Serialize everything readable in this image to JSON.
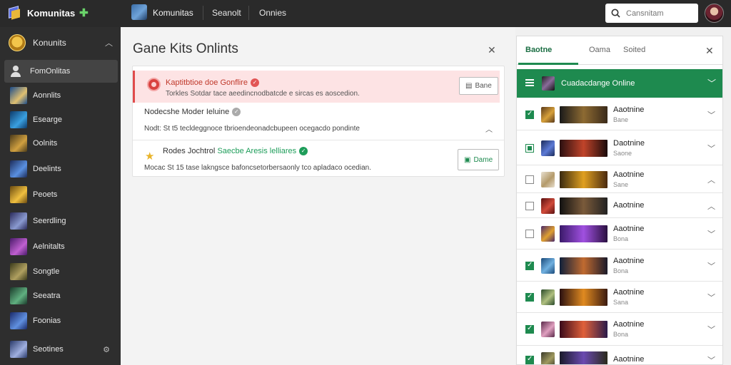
{
  "app": {
    "brand": "Komunitas",
    "header_title": "Komunitas",
    "nav": [
      "Seanolt",
      "Onnies"
    ]
  },
  "search": {
    "placeholder": "Cansnitam"
  },
  "sidebar": {
    "header": "Konunits",
    "active_item": "FomOnlitas",
    "items": [
      {
        "label": "Aonnlits",
        "icon": "game-thumb"
      },
      {
        "label": "Esearge",
        "icon": "game-thumb"
      },
      {
        "label": "Oolnits",
        "icon": "game-thumb"
      },
      {
        "label": "Deelints",
        "icon": "game-thumb"
      },
      {
        "label": "Peoets",
        "icon": "game-thumb"
      },
      {
        "label": "Seerdling",
        "icon": "game-thumb"
      },
      {
        "label": "Aelnitalts",
        "icon": "game-thumb"
      },
      {
        "label": "Songtle",
        "icon": "game-thumb"
      },
      {
        "label": "Seeatra",
        "icon": "game-thumb"
      },
      {
        "label": "Foonias",
        "icon": "game-thumb"
      },
      {
        "label": "Seotines",
        "icon": "game-thumb"
      }
    ]
  },
  "main": {
    "title": "Gane Kits Onlints",
    "alert": {
      "title": "Kaptitbtioe doe Gonflire",
      "desc": "Torkles Sotdar tace aeedincnodbatcde e sircas es aoscedion.",
      "button": "Bane"
    },
    "row1": {
      "title": "Nodecshe Moder Ieluine",
      "desc": "Nodt: St t5 tecldeggnoce tbrioendeonadcbupeen ocegacdo pondinte"
    },
    "row2": {
      "title": "Rodes Jochtrol",
      "link": "Saecbe Aresis lelliares",
      "desc": "Mocac St 15 tase lakngsce bafoncsetorbersaonly tco apladaco ocedian.",
      "button": "Dame"
    }
  },
  "rpanel": {
    "tabs": [
      "Baotne",
      "Oama",
      "Soited"
    ],
    "group_title": "Cuadacdange Online",
    "items": [
      {
        "title": "Aaotnine",
        "sub": "Bane",
        "state": "on",
        "expanded": false,
        "thumb": [
          "#5a3a1a",
          "#d7a03a"
        ],
        "banner": [
          "#1a1a1a",
          "#8d6a32",
          "#3a2a1a"
        ]
      },
      {
        "title": "Daotnine",
        "sub": "Saone",
        "state": "half",
        "expanded": false,
        "thumb": [
          "#1c2c5a",
          "#5c7ad6"
        ],
        "banner": [
          "#2a0f10",
          "#c0442a",
          "#1a0a0a"
        ]
      },
      {
        "title": "Aaotnine",
        "sub": "Sane",
        "state": "off",
        "expanded": true,
        "thumb": [
          "#e8e0d0",
          "#b49a6a"
        ],
        "banner": [
          "#3a2a10",
          "#e0a020",
          "#4a2a10"
        ]
      },
      {
        "title": "Aaotnine",
        "sub": "",
        "state": "off",
        "expanded": true,
        "thumb": [
          "#5a1010",
          "#d04a3a"
        ],
        "banner": [
          "#111111",
          "#7a5a3a",
          "#222222"
        ]
      },
      {
        "title": "Aaotnine",
        "sub": "Bona",
        "state": "off",
        "expanded": false,
        "thumb": [
          "#4a2a6a",
          "#e0a030"
        ],
        "banner": [
          "#3a1a6a",
          "#a050e0",
          "#2a1040"
        ]
      },
      {
        "title": "Aaotnine",
        "sub": "Bona",
        "state": "on",
        "expanded": false,
        "thumb": [
          "#1a4a7a",
          "#70b0e0"
        ],
        "banner": [
          "#10203a",
          "#c06a30",
          "#1a1a2a"
        ]
      },
      {
        "title": "Aaotnine",
        "sub": "Sana",
        "state": "on",
        "expanded": false,
        "thumb": [
          "#2a4a2a",
          "#b0c080"
        ],
        "banner": [
          "#2a1010",
          "#e08a20",
          "#3a1a10"
        ]
      },
      {
        "title": "Aaotnine",
        "sub": "Bona",
        "state": "on",
        "expanded": false,
        "thumb": [
          "#5a2a4a",
          "#e0a0c0"
        ],
        "banner": [
          "#3a0a1a",
          "#e0603a",
          "#2a1a4a"
        ]
      },
      {
        "title": "Aaotnine",
        "sub": "",
        "state": "on",
        "expanded": false,
        "thumb": [
          "#3a3a2a",
          "#a09a60"
        ],
        "banner": [
          "#1a1a2a",
          "#6a4ab0",
          "#2a2a1a"
        ]
      }
    ]
  },
  "colors": {
    "accent_green": "#1e8a4f",
    "alert_red": "#e04b4b",
    "sidebar_bg": "#2e2e2e"
  },
  "sidebar_thumbs": [
    [
      "#1b4c8a",
      "#e0c070"
    ],
    [
      "#0d3a6a",
      "#3aa0e0"
    ],
    [
      "#4a3a1a",
      "#d0a040"
    ],
    [
      "#1c2c5a",
      "#5a90e0"
    ],
    [
      "#6a4a10",
      "#f0c040"
    ],
    [
      "#2a2a5a",
      "#8a9ad0"
    ],
    [
      "#4a1a6a",
      "#c060d0"
    ],
    [
      "#3a3a1a",
      "#b0a060"
    ],
    [
      "#1a3a2a",
      "#60b080"
    ],
    [
      "#1a2a6a",
      "#6090e0"
    ],
    [
      "#2a3a6a",
      "#a0b0e0"
    ]
  ]
}
